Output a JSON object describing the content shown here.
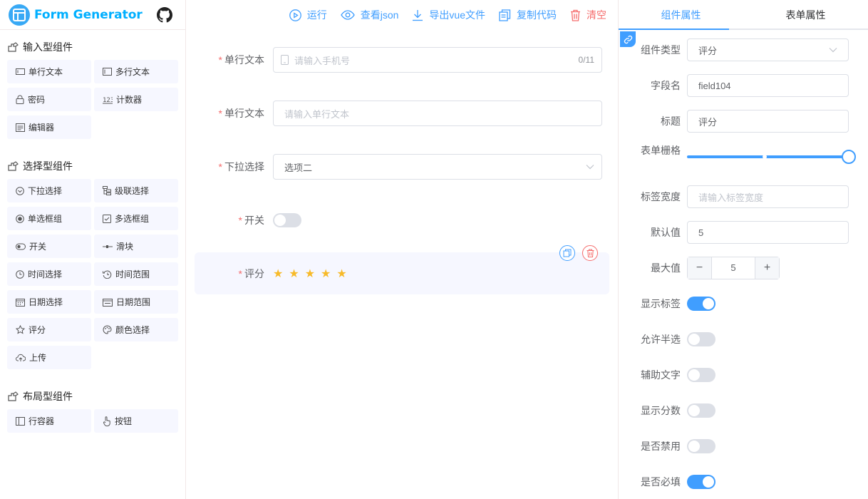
{
  "app": {
    "title": "Form Generator"
  },
  "toolbar": {
    "run": "运行",
    "view_json": "查看json",
    "export_vue": "导出vue文件",
    "copy_code": "复制代码",
    "clear": "清空"
  },
  "palette": {
    "input_group": {
      "title": "输入型组件",
      "items": [
        "单行文本",
        "多行文本",
        "密码",
        "计数器",
        "编辑器"
      ]
    },
    "select_group": {
      "title": "选择型组件",
      "items": [
        "下拉选择",
        "级联选择",
        "单选框组",
        "多选框组",
        "开关",
        "滑块",
        "时间选择",
        "时间范围",
        "日期选择",
        "日期范围",
        "评分",
        "颜色选择",
        "上传"
      ]
    },
    "layout_group": {
      "title": "布局型组件",
      "items": [
        "行容器",
        "按钮"
      ]
    }
  },
  "canvas": {
    "fields": [
      {
        "label": "单行文本",
        "placeholder": "请输入手机号",
        "counter": "0/11"
      },
      {
        "label": "单行文本",
        "placeholder": "请输入单行文本"
      },
      {
        "label": "下拉选择",
        "value": "选项二"
      },
      {
        "label": "开关",
        "switch_on": false
      },
      {
        "label": "评分",
        "stars": 5
      }
    ],
    "required_mark": "*",
    "star_glyph": "★"
  },
  "props": {
    "tabs": [
      "组件属性",
      "表单属性"
    ],
    "active_tab": 0,
    "rows": {
      "component_type": {
        "label": "组件类型",
        "value": "评分"
      },
      "field_name": {
        "label": "字段名",
        "value": "field104"
      },
      "title": {
        "label": "标题",
        "value": "评分"
      },
      "span": {
        "label": "表单栅格",
        "value": 24,
        "min": 1,
        "max": 24,
        "midpoint": 12
      },
      "label_width": {
        "label": "标签宽度",
        "placeholder": "请输入标签宽度"
      },
      "default_value": {
        "label": "默认值",
        "value": "5"
      },
      "max_value": {
        "label": "最大值",
        "value": "5",
        "minus": "−",
        "plus": "+"
      },
      "show_label": {
        "label": "显示标签",
        "on": true
      },
      "allow_half": {
        "label": "允许半选",
        "on": false
      },
      "show_text": {
        "label": "辅助文字",
        "on": false
      },
      "show_score": {
        "label": "显示分数",
        "on": false
      },
      "disabled": {
        "label": "是否禁用",
        "on": false
      },
      "required": {
        "label": "是否必填",
        "on": true
      }
    }
  },
  "colors": {
    "primary": "#409eff",
    "danger": "#f56c6c",
    "star": "#f7ba2a",
    "logo": "#00afff"
  }
}
